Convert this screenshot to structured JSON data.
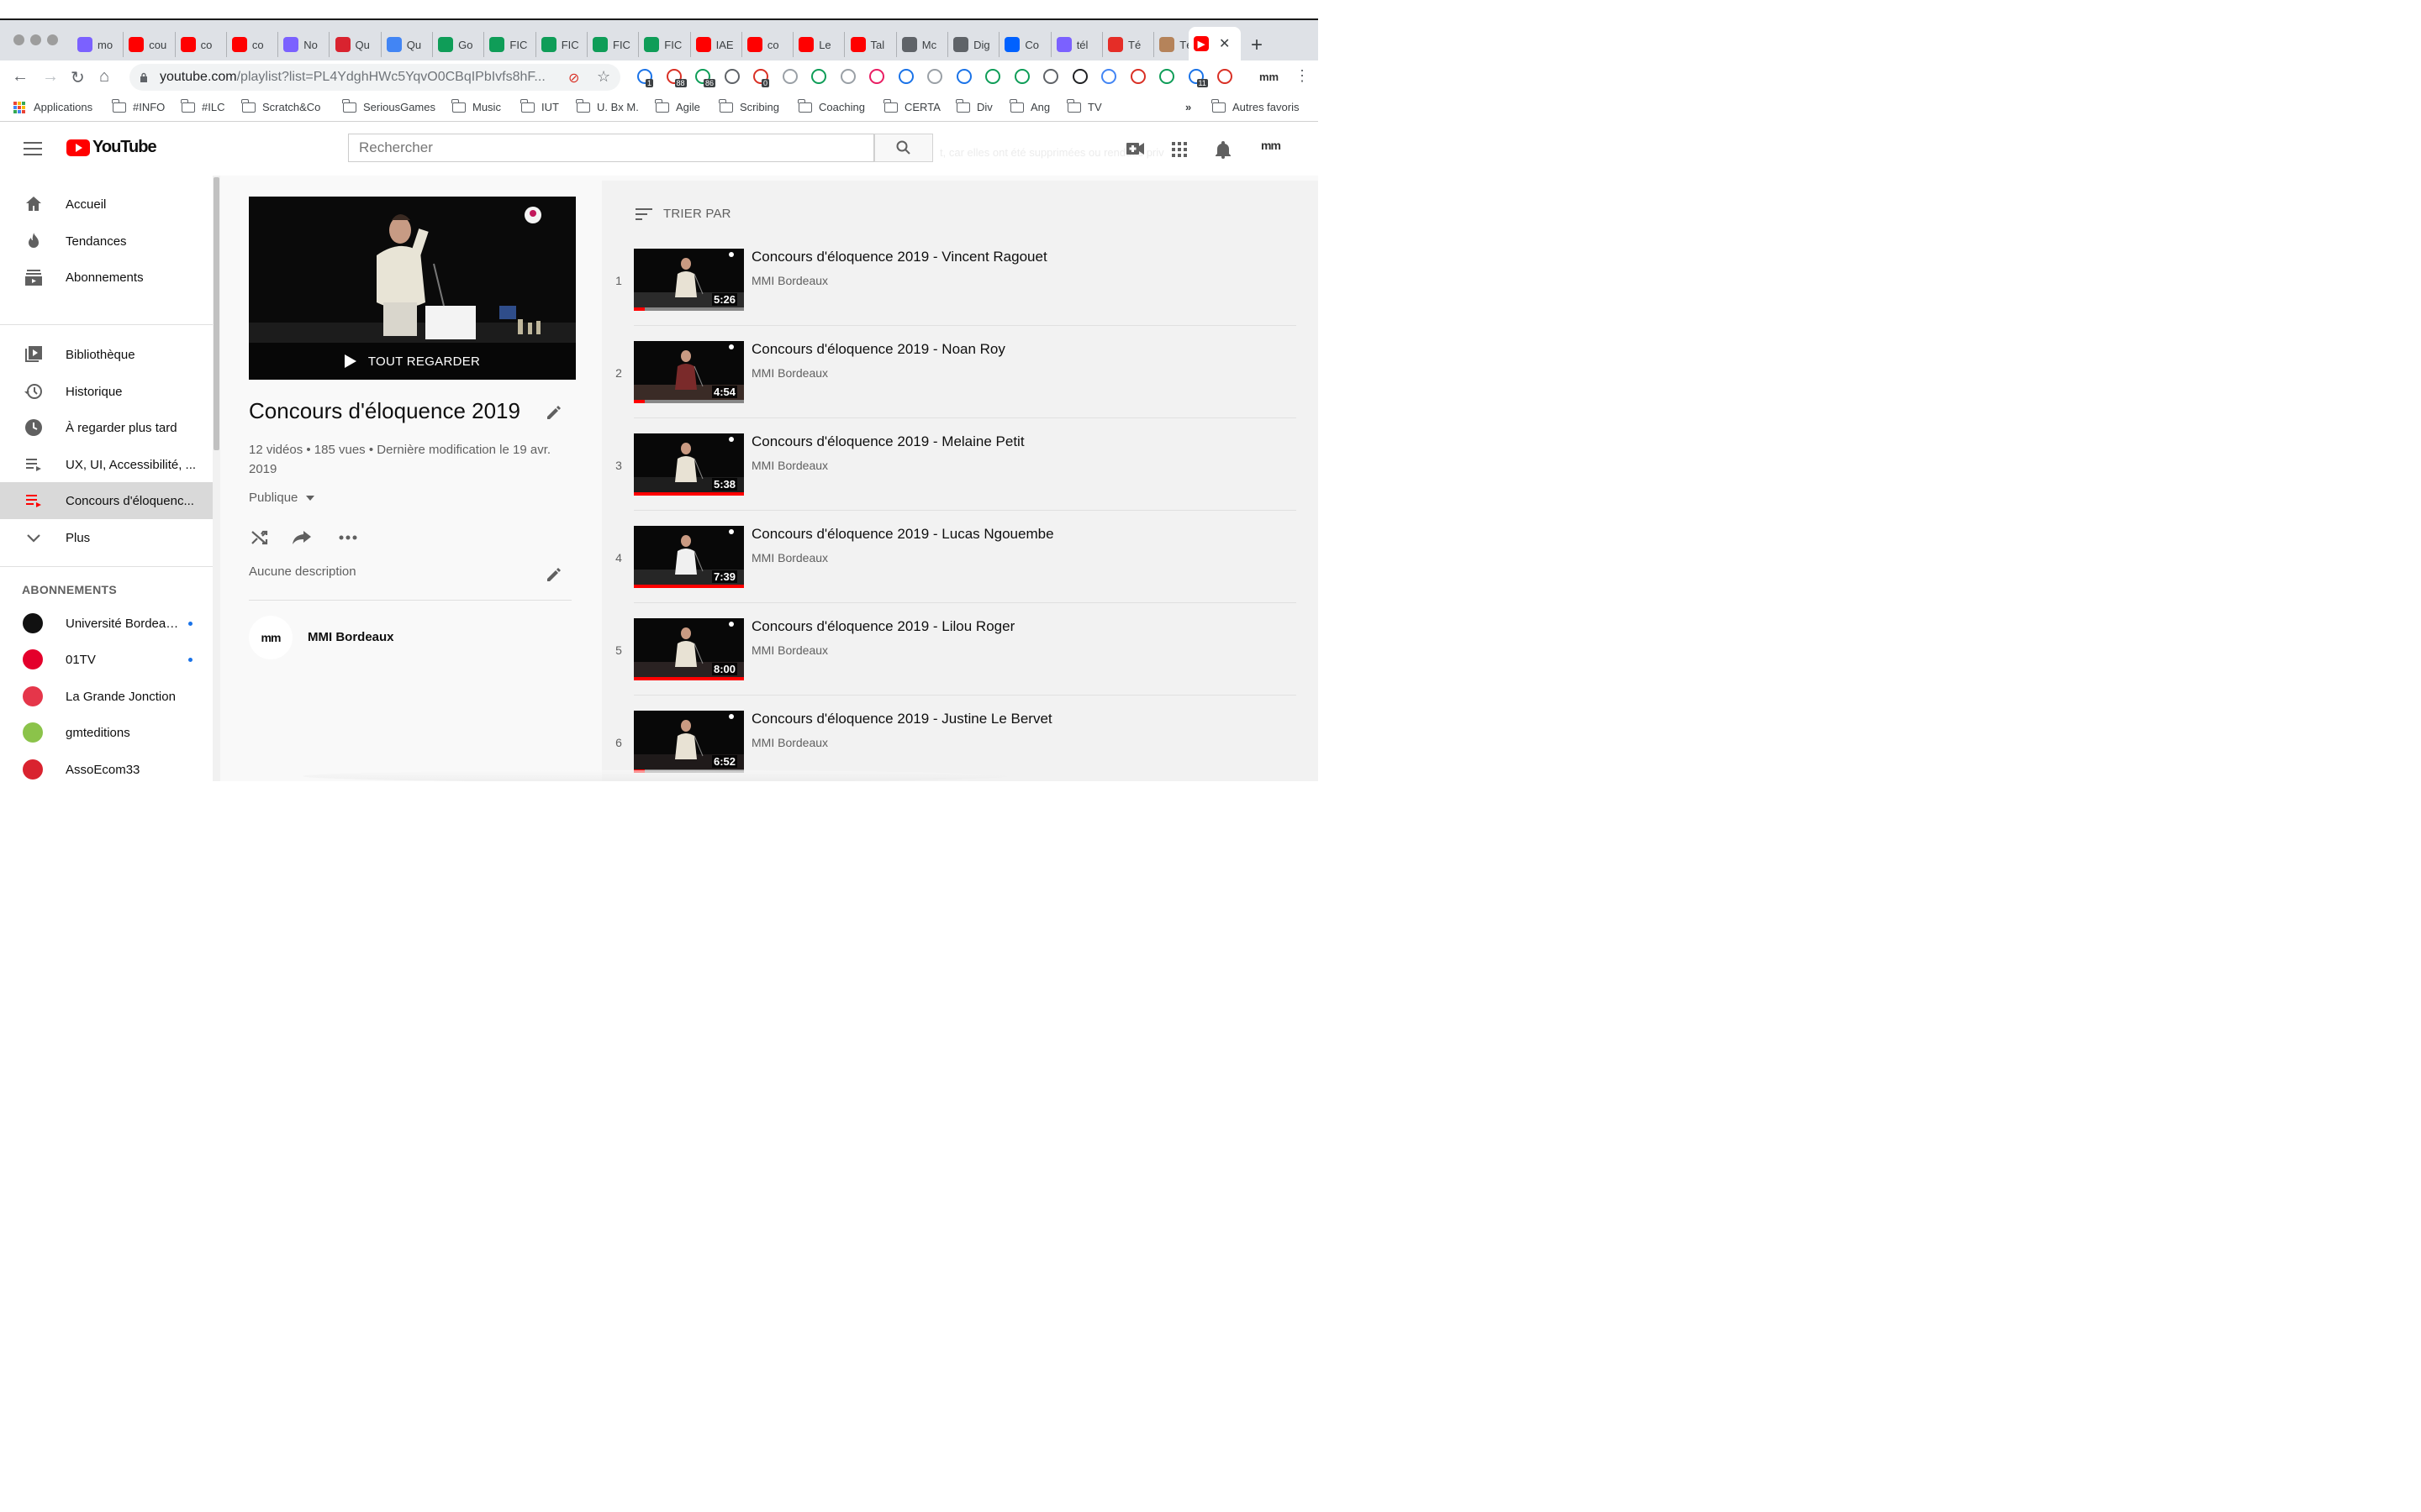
{
  "browser": {
    "tabs": [
      {
        "label": "mo",
        "icon": "q-icon",
        "color": "#7b61ff"
      },
      {
        "label": "cou",
        "icon": "youtube-icon",
        "color": "#ff0000"
      },
      {
        "label": "co",
        "icon": "youtube-icon",
        "color": "#ff0000"
      },
      {
        "label": "co",
        "icon": "youtube-icon",
        "color": "#ff0000"
      },
      {
        "label": "No",
        "icon": "q-icon",
        "color": "#7b61ff"
      },
      {
        "label": "Qu",
        "icon": "s-icon",
        "color": "#d9232f"
      },
      {
        "label": "Qu",
        "icon": "google-icon",
        "color": "#4285f4"
      },
      {
        "label": "Go",
        "icon": "drive-icon",
        "color": "#0f9d58"
      },
      {
        "label": "FIC",
        "icon": "sheets-icon",
        "color": "#0f9d58"
      },
      {
        "label": "FIC",
        "icon": "sheets-icon",
        "color": "#0f9d58"
      },
      {
        "label": "FIC",
        "icon": "sheets-icon",
        "color": "#0f9d58"
      },
      {
        "label": "FIC",
        "icon": "sheets-icon",
        "color": "#0f9d58"
      },
      {
        "label": "IAE",
        "icon": "youtube-icon",
        "color": "#ff0000"
      },
      {
        "label": "co",
        "icon": "youtube-icon",
        "color": "#ff0000"
      },
      {
        "label": "Le",
        "icon": "youtube-icon",
        "color": "#ff0000"
      },
      {
        "label": "Tal",
        "icon": "youtube-icon",
        "color": "#ff0000"
      },
      {
        "label": "Mc",
        "icon": "globe-icon",
        "color": "#5f6368"
      },
      {
        "label": "Dig",
        "icon": "globe-icon",
        "color": "#5f6368"
      },
      {
        "label": "Co",
        "icon": "dropbox-icon",
        "color": "#0061ff"
      },
      {
        "label": "tél",
        "icon": "q-icon",
        "color": "#7b61ff"
      },
      {
        "label": "Té",
        "icon": "yo-icon",
        "color": "#e52d27"
      },
      {
        "label": "Té",
        "icon": "cookie-icon",
        "color": "#b5835a"
      }
    ],
    "url_host": "youtube.com",
    "url_path": "/playlist?list=PL4YdghHWc5YqvO0CBqIPbIvfs8hF...",
    "bookmarks": [
      "Applications",
      "#INFO",
      "#ILC",
      "Scratch&Co",
      "SeriousGames",
      "Music",
      "IUT",
      "U. Bx M.",
      "Agile",
      "Scribing",
      "Coaching",
      "CERTA",
      "Div",
      "Ang",
      "TV"
    ],
    "bookmarks_more": "»",
    "other_bookmarks": "Autres favoris",
    "badges": [
      "1",
      "88",
      "86",
      "0",
      "11"
    ]
  },
  "header": {
    "logo_text": "YouTube",
    "search_placeholder": "Rechercher",
    "ghost_text": "t, car elles ont été supprimées ou rendues priv",
    "avatar_text": "mm"
  },
  "sidebar": {
    "main": [
      {
        "label": "Accueil",
        "icon": "home-icon"
      },
      {
        "label": "Tendances",
        "icon": "flame-icon"
      },
      {
        "label": "Abonnements",
        "icon": "subscriptions-icon"
      }
    ],
    "library": [
      {
        "label": "Bibliothèque",
        "icon": "library-icon"
      },
      {
        "label": "Historique",
        "icon": "history-icon"
      },
      {
        "label": "À regarder plus tard",
        "icon": "clock-icon"
      },
      {
        "label": "UX, UI, Accessibilité, ...",
        "icon": "playlist-icon"
      },
      {
        "label": "Concours d'éloquenc...",
        "icon": "playlist-active-icon"
      },
      {
        "label": "Plus",
        "icon": "chevron-down-icon"
      }
    ],
    "subs_heading": "ABONNEMENTS",
    "subs": [
      {
        "label": "Université Bordeau...",
        "new": true,
        "color": "#111111"
      },
      {
        "label": "01TV",
        "new": true,
        "color": "#e4002b"
      },
      {
        "label": "La Grande Jonction",
        "new": false,
        "color": "#e5364a"
      },
      {
        "label": "gmteditions",
        "new": false,
        "color": "#8bc34a"
      },
      {
        "label": "AssoEcom33",
        "new": false,
        "color": "#d9232f"
      }
    ]
  },
  "playlist": {
    "play_all": "TOUT REGARDER",
    "title": "Concours d'éloquence 2019",
    "meta": "12 vidéos • 185 vues • Dernière modification le 19 avr. 2019",
    "privacy": "Publique",
    "description": "Aucune description",
    "owner": "MMI Bordeaux",
    "owner_logo": "mm"
  },
  "list": {
    "sort_label": "TRIER PAR",
    "videos": [
      {
        "index": "1",
        "title": "Concours d'éloquence 2019 - Vincent Ragouet",
        "channel": "MMI Bordeaux",
        "duration": "5:26",
        "watched": 0.1
      },
      {
        "index": "2",
        "title": "Concours d'éloquence 2019 - Noan Roy",
        "channel": "MMI Bordeaux",
        "duration": "4:54",
        "watched": 0.1
      },
      {
        "index": "3",
        "title": "Concours d'éloquence 2019 - Melaine Petit",
        "channel": "MMI Bordeaux",
        "duration": "5:38",
        "watched": 1.0
      },
      {
        "index": "4",
        "title": "Concours d'éloquence 2019 - Lucas Ngouembe",
        "channel": "MMI Bordeaux",
        "duration": "7:39",
        "watched": 1.0
      },
      {
        "index": "5",
        "title": "Concours d'éloquence 2019 - Lilou Roger",
        "channel": "MMI Bordeaux",
        "duration": "8:00",
        "watched": 1.0
      },
      {
        "index": "6",
        "title": "Concours d'éloquence 2019 - Justine Le Bervet",
        "channel": "MMI Bordeaux",
        "duration": "6:52",
        "watched": 0.1
      }
    ]
  }
}
